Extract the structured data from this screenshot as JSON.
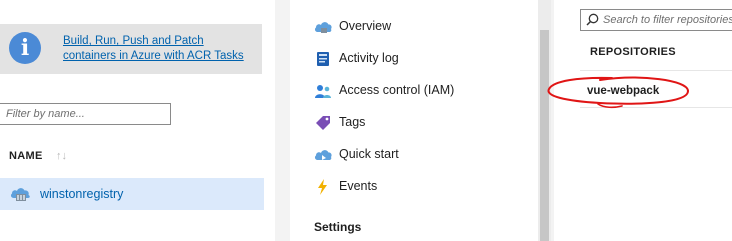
{
  "registry_list": {
    "banner": {
      "icon": "info-icon",
      "link_text": "Build, Run, Push and Patch containers in Azure with ACR Tasks"
    },
    "filter": {
      "placeholder": "Filter by name..."
    },
    "columns": [
      {
        "label": "NAME",
        "sort_icon": "sort-icon"
      }
    ],
    "rows": [
      {
        "name": "winstonregistry",
        "icon": "container-registry-icon",
        "selected": true
      }
    ]
  },
  "menu": {
    "items": [
      {
        "label": "Overview",
        "icon": "overview-cloud-icon"
      },
      {
        "label": "Activity log",
        "icon": "activity-log-icon"
      },
      {
        "label": "Access control (IAM)",
        "icon": "people-icon"
      },
      {
        "label": "Tags",
        "icon": "tag-icon"
      },
      {
        "label": "Quick start",
        "icon": "quickstart-cloud-icon"
      },
      {
        "label": "Events",
        "icon": "lightning-icon"
      }
    ],
    "sections": [
      {
        "heading": "Settings"
      }
    ]
  },
  "repositories": {
    "search": {
      "placeholder": "Search to filter repositories..."
    },
    "heading": "REPOSITORIES",
    "items": [
      {
        "name": "vue-webpack",
        "annotated": true
      }
    ]
  },
  "colors": {
    "accent": "#0062ad",
    "selected_row": "#dbe9fb",
    "banner_bg": "#e3e3e3",
    "annotation_red": "#e01515"
  }
}
